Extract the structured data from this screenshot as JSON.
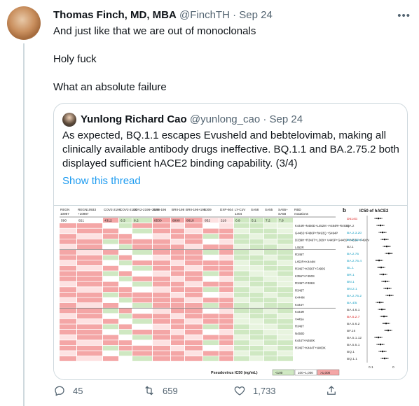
{
  "tweet": {
    "author_name": "Thomas Finch, MD, MBA",
    "author_handle": "@FinchTH",
    "separator": "·",
    "date": "Sep 24",
    "lines": [
      "And just like that we are out of monoclonals",
      "Holy fuck",
      "What an absolute failure"
    ]
  },
  "quote": {
    "author_name": "Yunlong Richard Cao",
    "author_handle": "@yunlong_cao",
    "separator": "·",
    "date": "Sep 24",
    "text": "As expected, BQ.1.1 escapes Evusheld and bebtelovimab, making all clinically available antibody drugs ineffective. BQ.1.1 and BA.2.75.2 both displayed sufficient hACE2 binding capability. (3/4)",
    "show_thread": "Show this thread"
  },
  "figure": {
    "columns": [
      "REGN 10987",
      "REGN10933 +10987",
      "COV2-2196",
      "COV2-2130",
      "COV2-2196+2130",
      "BRII-196",
      "BRII-198",
      "BRII-196+198",
      "S309",
      "DXP-604",
      "LY-CoV 1404",
      "SA58",
      "SA55",
      "SA55+ SA58",
      "RBD mutations"
    ],
    "top_row": [
      "590",
      "821",
      "4312",
      "6.3",
      "8.2",
      "8530",
      "8990",
      "8610",
      "852",
      "219",
      "0.9",
      "5.1",
      "7.2",
      "7.8"
    ],
    "panel_b_label": "b",
    "panel_b_title": "IC50 of hACE2",
    "variants": [
      "D614G",
      "BA.2",
      "BA.2.3.20",
      "BA.2.10.4",
      "BJ.1",
      "BA.2.75",
      "BA.2.75.4",
      "BL.1",
      "BR.1",
      "BN.1",
      "BN.2.1",
      "BA.2.75.2",
      "BA.4/5",
      "BA.4.6.1",
      "BA.5.2.7",
      "BA.5.6.2",
      "BF.16",
      "BA.5.1.12",
      "BA.5.5.1",
      "BQ.1",
      "BQ.1.1"
    ],
    "mutations": [
      "K444R+N450D+L452M +A484R+R493Q",
      "G446S+F486P+R493Q +S494P",
      "D339H+R346T+L368I+ V445P+G446S+V483A +F490V",
      "L452R",
      "R346T",
      "L452R+K444M",
      "R346T+K356T+F490S",
      "K356T+F490S",
      "R346T+F486S",
      "R346T",
      "K444M",
      "K444T",
      "K444R",
      "V445A",
      "R346T",
      "N450D",
      "K444T+N460K",
      "R346T+K444T+N460K"
    ],
    "axis_label": "Pseudovirus IC50 (ng/mL)",
    "legend": [
      "<100",
      "100~1,000",
      ">1,000"
    ],
    "axis_ticks": [
      "0.1",
      "0"
    ]
  },
  "actions": {
    "replies": "45",
    "retweets": "659",
    "likes": "1,733"
  },
  "colors": {
    "accent": "#1d9bf0",
    "red_cell": "#f4a6a6",
    "green_cell": "#cfe8c2"
  }
}
